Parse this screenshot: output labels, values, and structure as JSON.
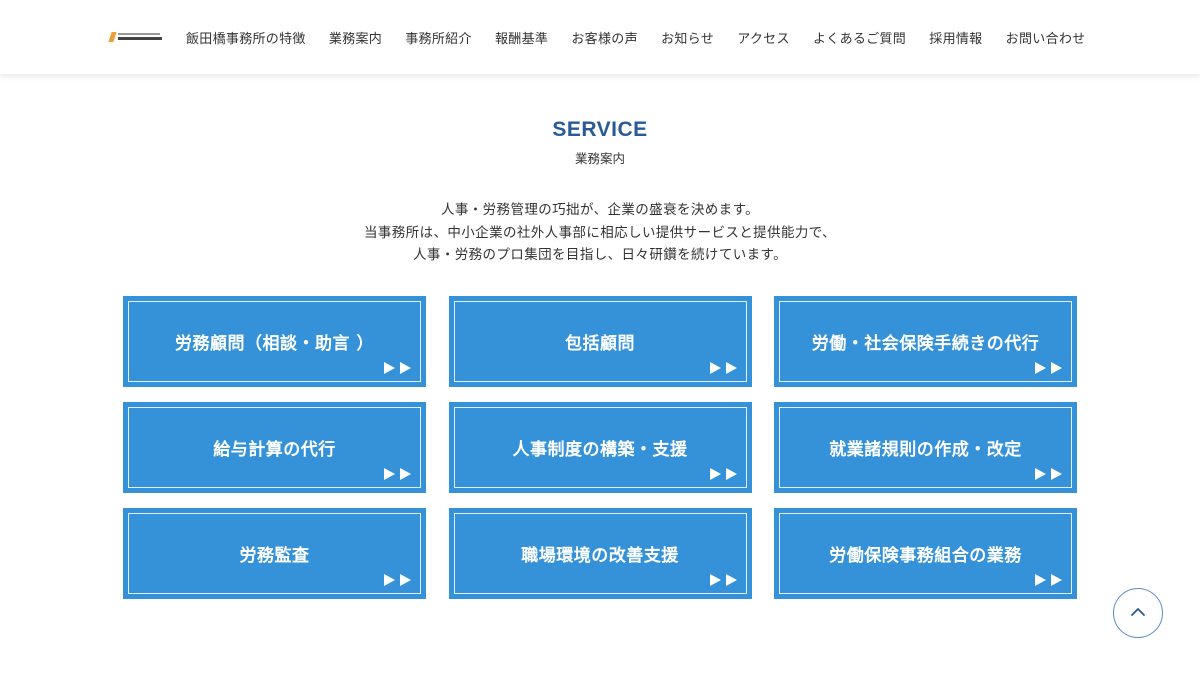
{
  "header": {
    "nav": [
      "飯田橋事務所の特徴",
      "業務案内",
      "事務所紹介",
      "報酬基準",
      "お客様の声",
      "お知らせ",
      "アクセス",
      "よくあるご質問",
      "採用情報",
      "お問い合わせ"
    ]
  },
  "section": {
    "title": "SERVICE",
    "subtitle": "業務案内",
    "intro": [
      "人事・労務管理の巧拙が、企業の盛衰を決めます。",
      "当事務所は、中小企業の社外人事部に相応しい提供サービスと提供能力で、",
      "人事・労務のプロ集団を目指し、日々研鑽を続けています。"
    ]
  },
  "services": [
    "労務顧問（相談・助言 ）",
    "包括顧問",
    "労働・社会保険手続きの代行",
    "給与計算の代行",
    "人事制度の構築・支援",
    "就業諸規則の作成・改定",
    "労務監査",
    "職場環境の改善支援",
    "労働保険事務組合の業務"
  ],
  "icons": {
    "card_arrow": "double-play-arrow-icon",
    "back_to_top": "chevron-up-icon"
  },
  "colors": {
    "card_bg": "#3592d8",
    "title": "#2a5a96",
    "totop_border": "#5a8cc4",
    "logo_accent": "#e8a23c"
  }
}
